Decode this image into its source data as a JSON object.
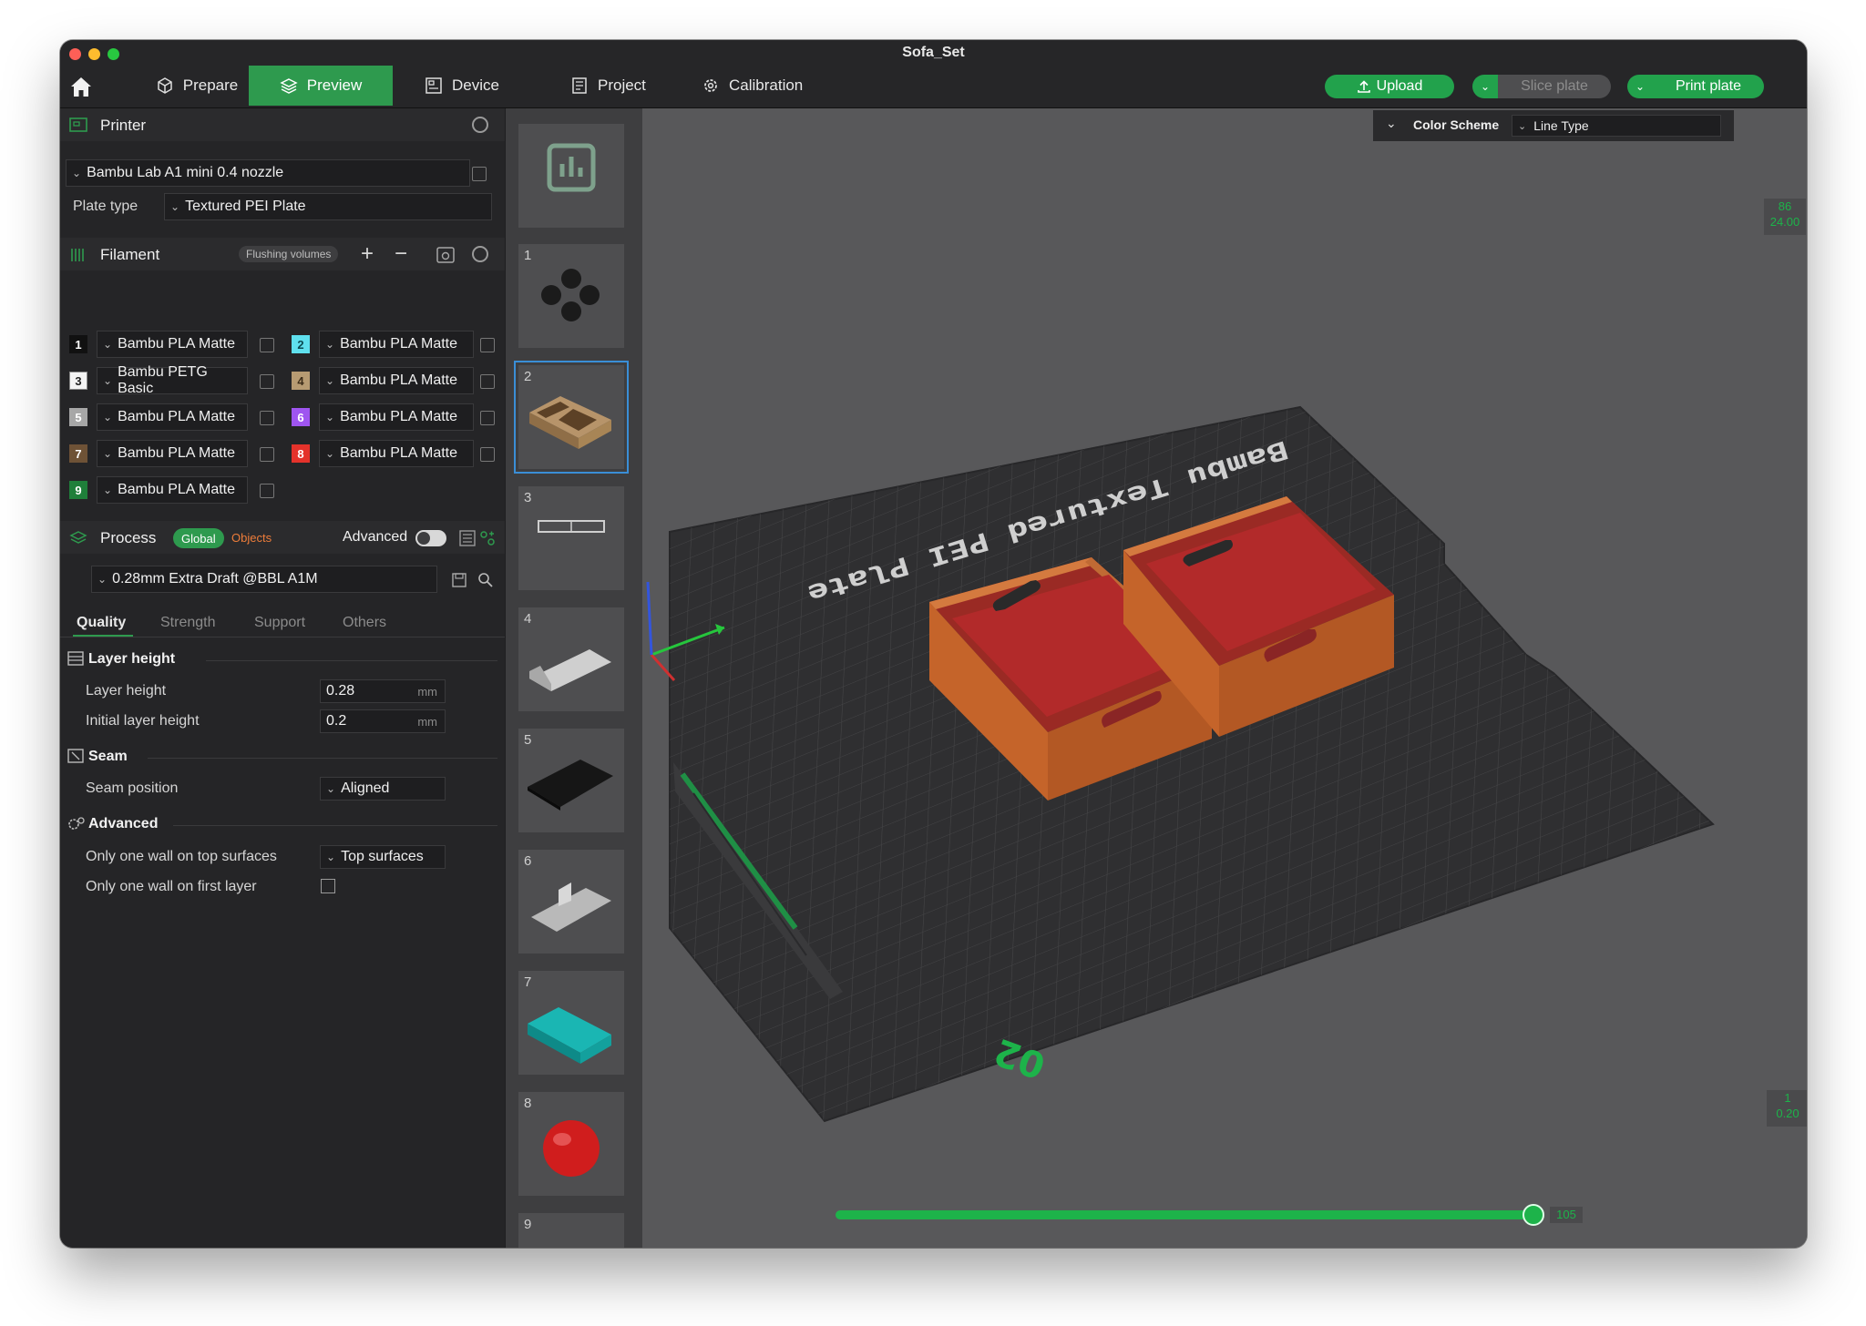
{
  "window": {
    "title": "Sofa_Set"
  },
  "toolbar": {
    "tabs": [
      {
        "label": "Prepare"
      },
      {
        "label": "Preview"
      },
      {
        "label": "Device"
      },
      {
        "label": "Project"
      },
      {
        "label": "Calibration"
      }
    ],
    "upload_label": "Upload",
    "slice_label": "Slice plate",
    "print_label": "Print plate"
  },
  "printer": {
    "section_label": "Printer",
    "model": "Bambu Lab A1 mini 0.4 nozzle",
    "plate_type_label": "Plate type",
    "plate_type": "Textured PEI Plate"
  },
  "filament": {
    "section_label": "Filament",
    "flushing_label": "Flushing volumes",
    "items": [
      {
        "num": "1",
        "name": "Bambu PLA Matte",
        "color": "#111111",
        "text": "#ffffff"
      },
      {
        "num": "2",
        "name": "Bambu PLA Matte",
        "color": "#5fe0ee",
        "text": "#0b4a52"
      },
      {
        "num": "3",
        "name": "Bambu PETG Basic",
        "color": "#f4f4f4",
        "text": "#222222"
      },
      {
        "num": "4",
        "name": "Bambu PLA Matte",
        "color": "#b79b72",
        "text": "#3b2c18"
      },
      {
        "num": "5",
        "name": "Bambu PLA Matte",
        "color": "#a7a7a7",
        "text": "#ffffff"
      },
      {
        "num": "6",
        "name": "Bambu PLA Matte",
        "color": "#9f55f0",
        "text": "#ffffff"
      },
      {
        "num": "7",
        "name": "Bambu PLA Matte",
        "color": "#6e5236",
        "text": "#ffffff"
      },
      {
        "num": "8",
        "name": "Bambu PLA Matte",
        "color": "#e4322b",
        "text": "#ffffff"
      },
      {
        "num": "9",
        "name": "Bambu PLA Matte",
        "color": "#1f7f3a",
        "text": "#ffffff"
      }
    ]
  },
  "process": {
    "section_label": "Process",
    "global_label": "Global",
    "objects_label": "Objects",
    "advanced_label": "Advanced",
    "advanced_on": false,
    "preset": "0.28mm Extra Draft @BBL A1M",
    "tabs": [
      "Quality",
      "Strength",
      "Support",
      "Others"
    ],
    "layer_height_head": "Layer height",
    "layer_height_label": "Layer height",
    "layer_height": "0.28",
    "initial_layer_label": "Initial layer height",
    "initial_layer": "0.2",
    "unit": "mm",
    "seam_head": "Seam",
    "seam_position_label": "Seam position",
    "seam_position": "Aligned",
    "advanced_head": "Advanced",
    "one_wall_top_label": "Only one wall on top surfaces",
    "one_wall_top": "Top surfaces",
    "one_wall_first_label": "Only one wall on first layer",
    "one_wall_first": false
  },
  "plates": {
    "numbers": [
      "1",
      "2",
      "3",
      "4",
      "5",
      "6",
      "7",
      "8",
      "9"
    ],
    "selected": 2
  },
  "viewport": {
    "color_scheme_label": "Color Scheme",
    "color_scheme": "Line Type",
    "bed_text": "Bambu Textured PEI Plate",
    "plate_number": "02",
    "layer_top_num": "86",
    "layer_top_height": "24.00",
    "layer_bottom_num": "1",
    "layer_bottom_height": "0.20",
    "move_value": "105",
    "accent": "#1db34a",
    "box_color": "#c5642a",
    "box_inner": "#b02a2a"
  }
}
